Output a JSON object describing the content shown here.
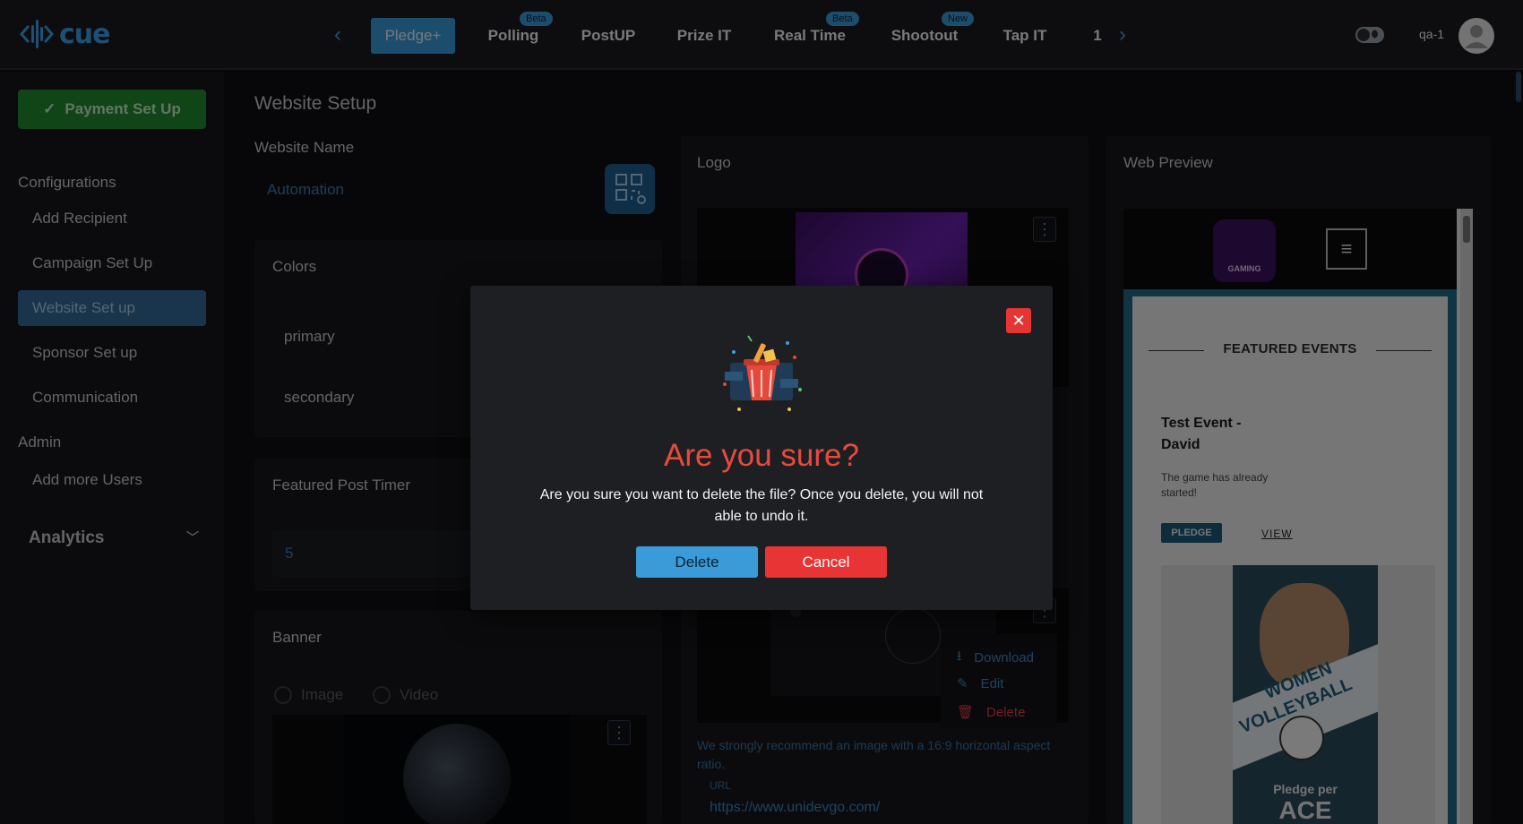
{
  "brand": {
    "name": "cue",
    "accent": "#3aa0e8"
  },
  "topnav": {
    "tabs": [
      {
        "label": "Pledge+",
        "active": true
      },
      {
        "label": "Polling",
        "badge": "Beta"
      },
      {
        "label": "PostUP"
      },
      {
        "label": "Prize IT"
      },
      {
        "label": "Real Time",
        "badge": "Beta"
      },
      {
        "label": "Shootout",
        "badge": "New"
      },
      {
        "label": "Tap IT"
      },
      {
        "label": "1"
      }
    ],
    "user": "qa-1"
  },
  "sidebar": {
    "payment_button": "Payment Set Up",
    "configurations_heading": "Configurations",
    "items": [
      "Add Recipient",
      "Campaign Set Up",
      "Website Set up",
      "Sponsor Set up",
      "Communication"
    ],
    "active_item": "Website Set up",
    "admin_heading": "Admin",
    "admin_items": [
      "Add more Users"
    ],
    "analytics": "Analytics"
  },
  "main": {
    "title": "Website Setup",
    "website_name_label": "Website Name",
    "website_name_value": "Automation",
    "colors_label": "Colors",
    "color_rows": [
      "primary",
      "secondary"
    ],
    "featured_timer_label": "Featured Post Timer",
    "featured_timer_value": "5",
    "banner_label": "Banner",
    "banner_options": [
      "Image",
      "Video"
    ],
    "logo_label": "Logo",
    "logo_hint": "We strongly recommend an image with a 16:9 horizontal aspect ratio.",
    "url_label": "URL",
    "url_value": "https://www.unidevgo.com/",
    "context_menu": [
      "Download",
      "Edit",
      "Delete"
    ]
  },
  "web_preview": {
    "label": "Web Preview",
    "logo_text": "GAMING",
    "heading": "FEATURED EVENTS",
    "event_title": "Test Event - David",
    "event_desc": "The game has already started!",
    "pledge_button": "PLEDGE",
    "view_link": "VIEW",
    "poster_line1": "WOMEN",
    "poster_line2": "VOLLEYBALL",
    "poster_pledge": "Pledge per",
    "poster_ace": "ACE"
  },
  "modal": {
    "title": "Are you sure?",
    "message": "Are you sure you want to delete the file? Once you delete, you will not able to undo it.",
    "delete_button": "Delete",
    "cancel_button": "Cancel"
  },
  "colors": {
    "primary_blue": "#3a9bd8",
    "danger": "#e83434",
    "success": "#1f8a2e"
  },
  "icons": [
    "chevron-left-icon",
    "chevron-right-icon",
    "theme-toggle-icon",
    "user-avatar-icon",
    "check-icon",
    "chevron-down-icon",
    "qr-link-icon",
    "kebab-menu-icon",
    "download-icon",
    "edit-icon",
    "trash-icon",
    "close-icon",
    "trash-can-illustration",
    "hamburger-icon"
  ]
}
